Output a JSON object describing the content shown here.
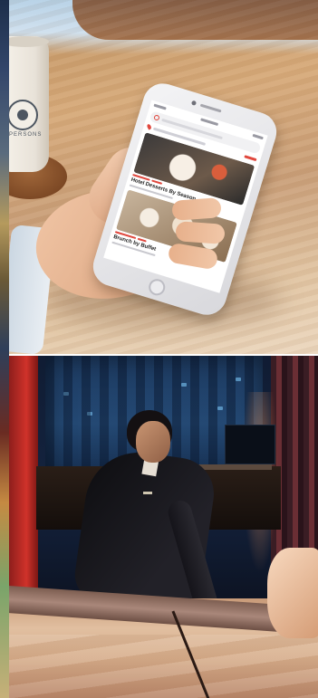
{
  "photos": {
    "top": {
      "mug_text": "PERSONS",
      "app_cards": [
        {
          "title": "Hotel Desserts By Season"
        },
        {
          "title": "Brunch by Buffet"
        }
      ]
    },
    "bottom": {}
  }
}
